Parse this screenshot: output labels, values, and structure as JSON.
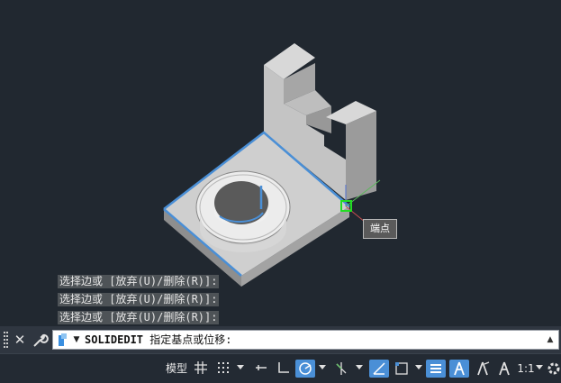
{
  "viewport": {
    "background": "#212830",
    "tooltip_text": "端点"
  },
  "command_history": [
    "选择边或 [放弃(U)/删除(R)]:",
    "选择边或 [放弃(U)/删除(R)]:",
    "选择边或 [放弃(U)/删除(R)]:"
  ],
  "command_line": {
    "command": "SOLIDEDIT",
    "prompt": "指定基点或位移:"
  },
  "status_bar": {
    "model_label": "模型",
    "scale_label": "1:1",
    "accent": "#4a8fd6"
  },
  "icons": [
    "grip-icon",
    "close-icon",
    "wrench-icon",
    "command-icon",
    "chevron-down-icon",
    "chevron-up-icon",
    "grid-icon",
    "snap-icon",
    "ortho-icon",
    "polar-icon",
    "osnap-icon",
    "dynamic-ucs-icon",
    "lineweight-icon",
    "selection-cycling-icon",
    "annotation-icon",
    "gear-icon"
  ]
}
